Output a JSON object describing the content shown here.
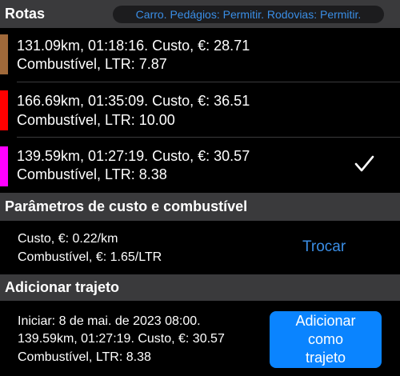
{
  "routes_section": {
    "title": "Rotas",
    "options_label": "Carro. Pedágios: Permitir. Rodovias: Permitir."
  },
  "routes": [
    {
      "line1": "131.09km, 01:18:16. Custo, €: 28.71",
      "line2": "Combustível, LTR: 7.87",
      "color": "#a0693a",
      "selected": false
    },
    {
      "line1": "166.69km, 01:35:09. Custo, €: 36.51",
      "line2": "Combustível, LTR: 10.00",
      "color": "#ff0000",
      "selected": false
    },
    {
      "line1": "139.59km, 01:27:19. Custo, €: 30.57",
      "line2": "Combustível, LTR: 8.38",
      "color": "#ff00ff",
      "selected": true
    }
  ],
  "params_section": {
    "title": "Parâmetros de custo e combustível",
    "cost_line": "Custo, €: 0.22/km",
    "fuel_line": "Combustível, €: 1.65/LTR",
    "change_label": "Trocar"
  },
  "add_section": {
    "title": "Adicionar trajeto",
    "start_line": "Iniciar: 8 de mai. de 2023 08:00.",
    "route_line": "139.59km, 01:27:19. Custo, €: 30.57",
    "fuel_line": "Combustível, LTR: 8.38",
    "button_lines": [
      "Adicionar",
      "como",
      "trajeto"
    ]
  },
  "colors": {
    "accent": "#0a84ff",
    "link": "#3a8ee6",
    "header_bg": "#3a3a3c"
  },
  "icons": {
    "selected": "checkmark-icon"
  }
}
